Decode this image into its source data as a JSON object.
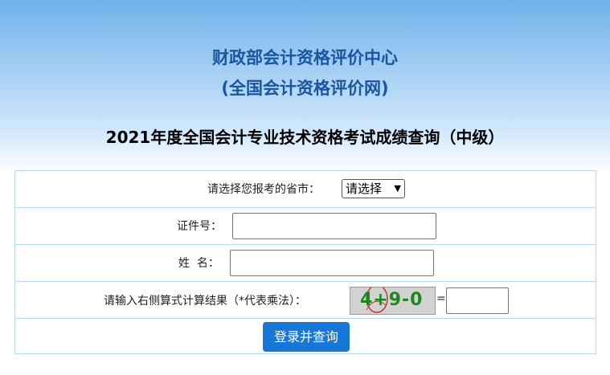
{
  "header": {
    "org_line1": "财政部会计资格评价中心",
    "org_line2": "(全国会计资格评价网)",
    "exam_title": "2021年度全国会计专业技术资格考试成绩查询（中级）"
  },
  "form": {
    "province_label": "请选择您报考的省市：",
    "province_select_value": "请选择",
    "id_label": "证件号：",
    "id_value": "",
    "name_label": "姓  名：",
    "name_value": "",
    "captcha_label": "请输入右侧算式计算结果（*代表乘法）：",
    "captcha_text": "4+9-0",
    "equals_sign": "=",
    "captcha_answer": "",
    "submit_label": "登录并查询"
  },
  "colors": {
    "org_title": "#1a56a0",
    "button_bg": "#1677d6",
    "border": "#b7dbef",
    "captcha_text": "#1a8a1a",
    "captcha_mark": "#c0392b"
  }
}
